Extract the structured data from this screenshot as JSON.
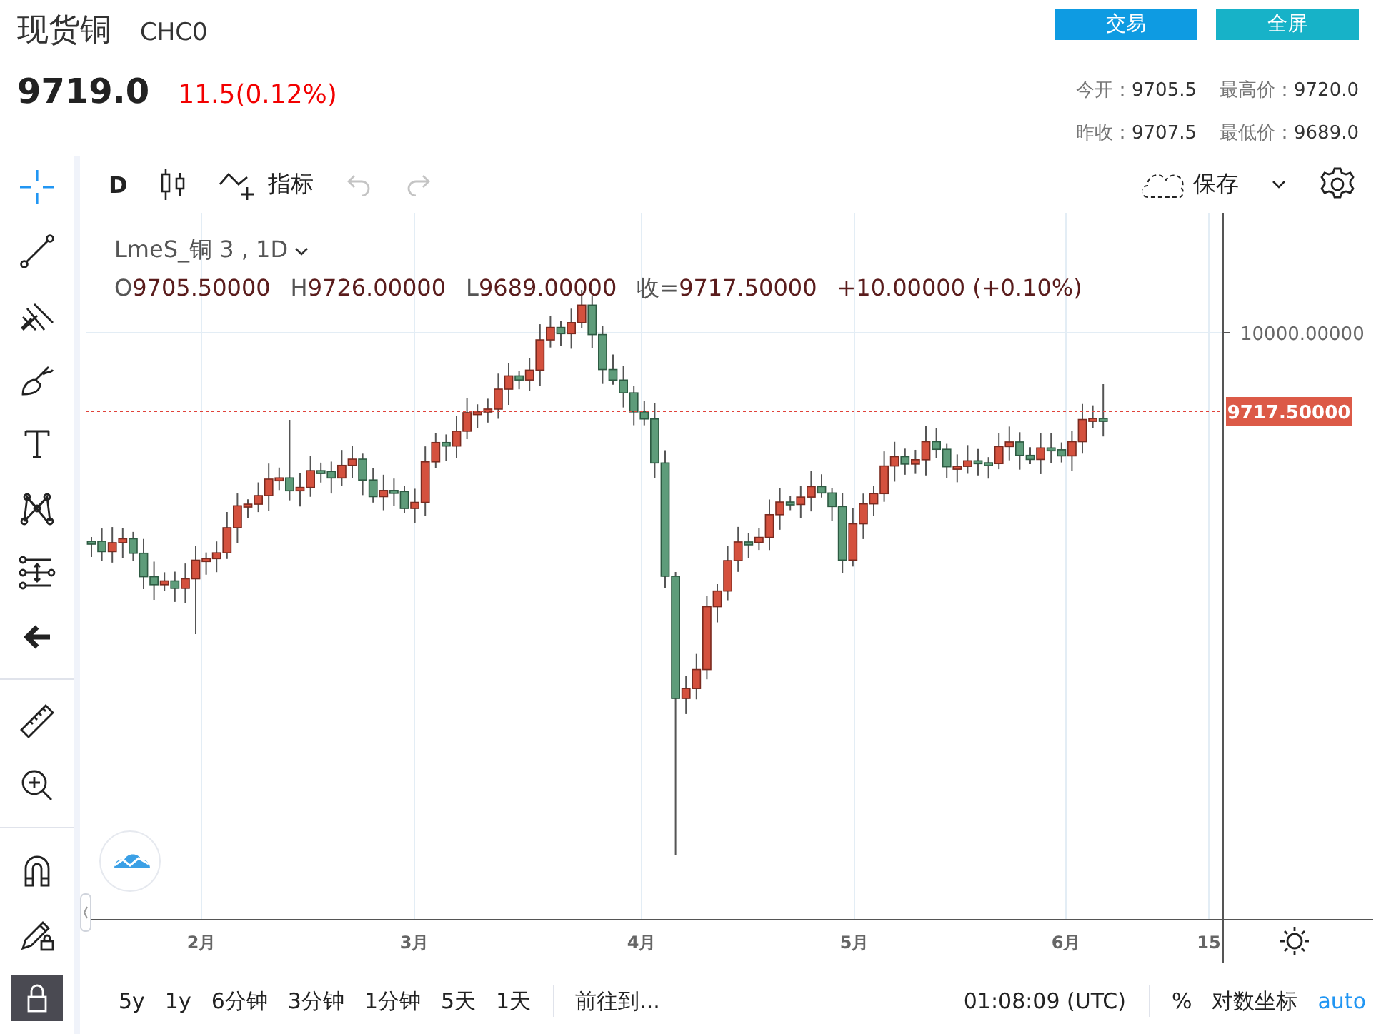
{
  "header": {
    "title": "现货铜",
    "symbol": "CHC0",
    "price": "9719.0",
    "change": "11.5(0.12%)"
  },
  "buttons": [
    {
      "label": "交易",
      "kind": "trade"
    },
    {
      "label": "全屏",
      "kind": "fullscreen"
    }
  ],
  "stats": [
    [
      {
        "label": "今开：",
        "value": "9705.5"
      },
      {
        "label": "最高价：",
        "value": "9720.0"
      }
    ],
    [
      {
        "label": "昨收：",
        "value": "9707.5"
      },
      {
        "label": "最低价：",
        "value": "9689.0"
      }
    ]
  ],
  "toolbar": {
    "interval": "D",
    "indicators": "指标",
    "save": "保存"
  },
  "tools": [
    {
      "kind": "crosshair",
      "selected": true
    },
    {
      "kind": "trendline",
      "selected": false
    },
    {
      "kind": "fork",
      "selected": false
    },
    {
      "kind": "brush",
      "selected": false
    },
    {
      "kind": "text",
      "selected": false
    },
    {
      "kind": "pattern",
      "selected": false
    },
    {
      "kind": "measure-range",
      "selected": false
    },
    {
      "kind": "back",
      "selected": false
    },
    {
      "kind": "divider"
    },
    {
      "kind": "ruler",
      "selected": false
    },
    {
      "kind": "zoom",
      "selected": false
    },
    {
      "kind": "divider"
    },
    {
      "kind": "magnet",
      "selected": false
    },
    {
      "kind": "lock-pencil",
      "selected": false
    },
    {
      "kind": "lock",
      "selected": true
    }
  ],
  "legend": {
    "title": "LmeS_铜 3 , 1D",
    "items": [
      {
        "label": "O",
        "value": "9705.50000"
      },
      {
        "label": "H",
        "value": "9726.00000"
      },
      {
        "label": "L",
        "value": "9689.00000"
      },
      {
        "label": "收=",
        "value": "9717.50000"
      }
    ],
    "change": "+10.00000 (+0.10%)"
  },
  "price_axis": {
    "tick": "10000.00000",
    "current": "9717.50000"
  },
  "time_axis": [
    "2月",
    "3月",
    "4月",
    "5月",
    "6月",
    "15"
  ],
  "bottom_bar": {
    "ranges": [
      "5y",
      "1y",
      "6分钟",
      "3分钟",
      "1分钟",
      "5天",
      "1天"
    ],
    "goto": "前往到...",
    "time": "01:08:09 (UTC)",
    "percent": "%",
    "log": "对数坐标",
    "auto": "auto"
  }
}
